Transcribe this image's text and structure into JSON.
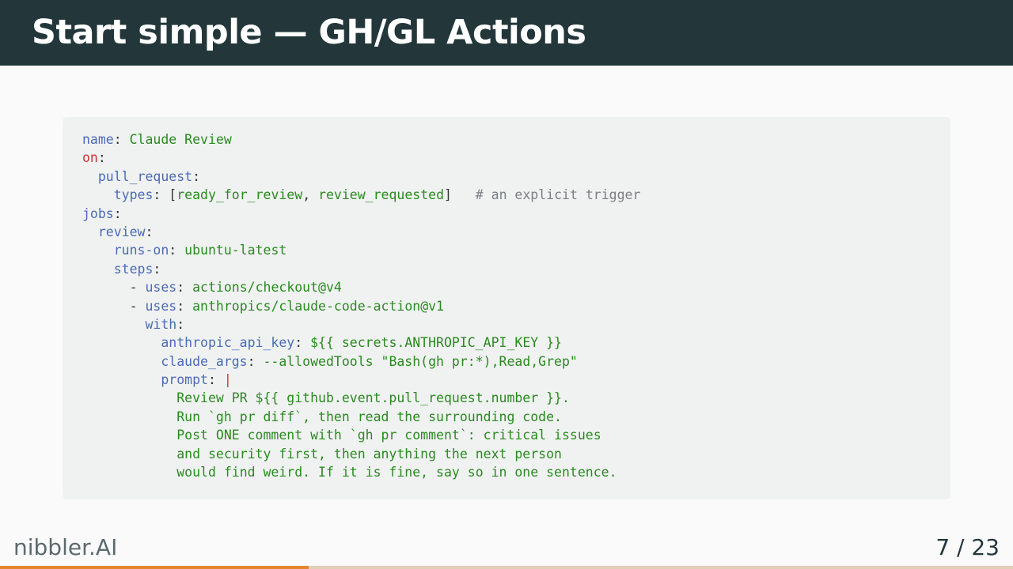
{
  "slide": {
    "title": "Start simple — GH/GL Actions"
  },
  "code": {
    "lines": [
      [
        {
          "t": "k",
          "v": "name"
        },
        {
          "t": "p",
          "v": ": "
        },
        {
          "t": "s",
          "v": "Claude Review"
        }
      ],
      [
        {
          "t": "r",
          "v": "on"
        },
        {
          "t": "p",
          "v": ":"
        }
      ],
      [
        {
          "t": "p",
          "v": "  "
        },
        {
          "t": "k",
          "v": "pull_request"
        },
        {
          "t": "p",
          "v": ":"
        }
      ],
      [
        {
          "t": "p",
          "v": "    "
        },
        {
          "t": "k",
          "v": "types"
        },
        {
          "t": "p",
          "v": ": ["
        },
        {
          "t": "s",
          "v": "ready_for_review"
        },
        {
          "t": "p",
          "v": ", "
        },
        {
          "t": "s",
          "v": "review_requested"
        },
        {
          "t": "p",
          "v": "]   "
        },
        {
          "t": "c",
          "v": "# an explicit trigger"
        }
      ],
      [
        {
          "t": "k",
          "v": "jobs"
        },
        {
          "t": "p",
          "v": ":"
        }
      ],
      [
        {
          "t": "p",
          "v": "  "
        },
        {
          "t": "k",
          "v": "review"
        },
        {
          "t": "p",
          "v": ":"
        }
      ],
      [
        {
          "t": "p",
          "v": "    "
        },
        {
          "t": "k",
          "v": "runs-on"
        },
        {
          "t": "p",
          "v": ": "
        },
        {
          "t": "s",
          "v": "ubuntu-latest"
        }
      ],
      [
        {
          "t": "p",
          "v": "    "
        },
        {
          "t": "k",
          "v": "steps"
        },
        {
          "t": "p",
          "v": ":"
        }
      ],
      [
        {
          "t": "p",
          "v": "      - "
        },
        {
          "t": "k",
          "v": "uses"
        },
        {
          "t": "p",
          "v": ": "
        },
        {
          "t": "s",
          "v": "actions/checkout@v4"
        }
      ],
      [
        {
          "t": "p",
          "v": "      - "
        },
        {
          "t": "k",
          "v": "uses"
        },
        {
          "t": "p",
          "v": ": "
        },
        {
          "t": "s",
          "v": "anthropics/claude-code-action@v1"
        }
      ],
      [
        {
          "t": "p",
          "v": "        "
        },
        {
          "t": "k",
          "v": "with"
        },
        {
          "t": "p",
          "v": ":"
        }
      ],
      [
        {
          "t": "p",
          "v": "          "
        },
        {
          "t": "k",
          "v": "anthropic_api_key"
        },
        {
          "t": "p",
          "v": ": "
        },
        {
          "t": "s",
          "v": "${{ secrets.ANTHROPIC_API_KEY }}"
        }
      ],
      [
        {
          "t": "p",
          "v": "          "
        },
        {
          "t": "k",
          "v": "claude_args"
        },
        {
          "t": "p",
          "v": ": "
        },
        {
          "t": "s",
          "v": "--allowedTools \"Bash(gh pr:*),Read,Grep\""
        }
      ],
      [
        {
          "t": "p",
          "v": "          "
        },
        {
          "t": "k",
          "v": "prompt"
        },
        {
          "t": "p",
          "v": ": "
        },
        {
          "t": "r",
          "v": "|"
        }
      ],
      [
        {
          "t": "p",
          "v": "            "
        },
        {
          "t": "s",
          "v": "Review PR ${{ github.event.pull_request.number }}."
        }
      ],
      [
        {
          "t": "p",
          "v": "            "
        },
        {
          "t": "s",
          "v": "Run `gh pr diff`, then read the surrounding code."
        }
      ],
      [
        {
          "t": "p",
          "v": "            "
        },
        {
          "t": "s",
          "v": "Post ONE comment with `gh pr comment`: critical issues"
        }
      ],
      [
        {
          "t": "p",
          "v": "            "
        },
        {
          "t": "s",
          "v": "and security first, then anything the next person"
        }
      ],
      [
        {
          "t": "p",
          "v": "            "
        },
        {
          "t": "s",
          "v": "would find weird. If it is fine, say so in one sentence."
        }
      ]
    ]
  },
  "footer": {
    "brand": "nibbler.AI",
    "page_current": "7",
    "page_separator": "/",
    "page_total": "23",
    "page_label": "7 / 23"
  },
  "progress": {
    "fraction": 0.3043
  },
  "colors": {
    "title_bg": "#23373b",
    "accent": "#e4862b",
    "yaml_key": "#4a6bb8",
    "yaml_string": "#2a8a1f",
    "yaml_reserved": "#cc3333",
    "yaml_comment": "#7a7f82"
  }
}
